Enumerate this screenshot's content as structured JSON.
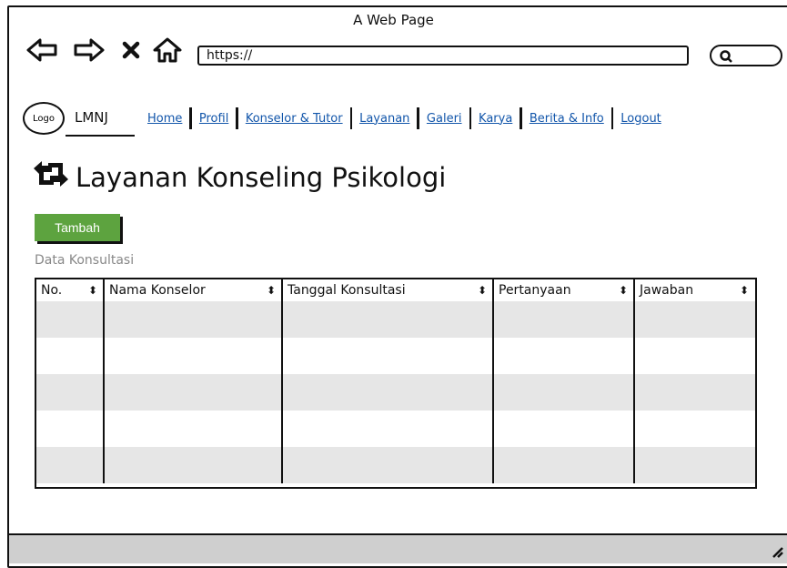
{
  "window": {
    "title": "A Web Page",
    "url": "https://"
  },
  "icons": {
    "back": "arrow-left-icon",
    "forward": "arrow-right-icon",
    "stop": "close-icon",
    "home": "home-icon",
    "search": "search-icon",
    "title": "repeat-icon",
    "sort": "sort-icon",
    "resize": "resize-grip-icon"
  },
  "header": {
    "logo": "Logo",
    "brand": "LMNJ",
    "nav": [
      {
        "label": "Home"
      },
      {
        "label": "Profil"
      },
      {
        "label": "Konselor & Tutor"
      },
      {
        "label": "Layanan"
      },
      {
        "label": "Galeri"
      },
      {
        "label": "Karya"
      },
      {
        "label": "Berita & Info"
      },
      {
        "label": "Logout"
      }
    ]
  },
  "main": {
    "title": "Layanan Konseling Psikologi",
    "add_label": "Tambah",
    "table_caption": "Data Konsultasi",
    "columns": [
      "No.",
      "Nama Konselor",
      "Tanggal Konsultasi",
      "Pertanyaan",
      "Jawaban"
    ],
    "sort_glyph": "⬍",
    "rows": [
      [
        "",
        "",
        "",
        "",
        ""
      ],
      [
        "",
        "",
        "",
        "",
        ""
      ],
      [
        "",
        "",
        "",
        "",
        ""
      ],
      [
        "",
        "",
        "",
        "",
        ""
      ],
      [
        "",
        "",
        "",
        "",
        ""
      ]
    ]
  },
  "colors": {
    "accent": "#5da33f",
    "link": "#1155aa",
    "chrome": "#e8e8e8",
    "row_shade": "#e6e6e6"
  }
}
